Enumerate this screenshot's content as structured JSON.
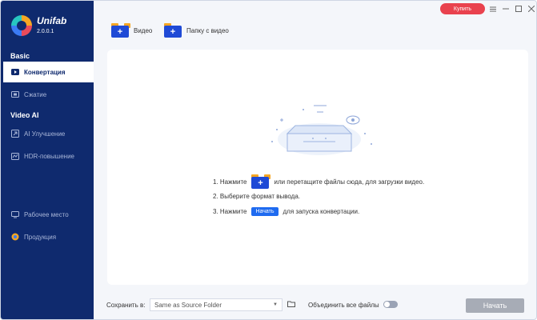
{
  "app": {
    "name": "Unifab",
    "version": "2.0.0.1"
  },
  "topbar": {
    "buy_label": "Купить",
    "add_video_label": "Видео",
    "add_folder_label": "Папку с видео"
  },
  "sidebar": {
    "section_basic": "Basic",
    "section_ai": "Video AI",
    "items": [
      {
        "label": "Конвертация",
        "icon": "play-icon"
      },
      {
        "label": "Сжатие",
        "icon": "compress-icon"
      },
      {
        "label": "AI Улучшение",
        "icon": "ai-upscale-icon"
      },
      {
        "label": "HDR-повышение",
        "icon": "hdr-icon"
      },
      {
        "label": "Рабочее место",
        "icon": "desktop-icon"
      },
      {
        "label": "Продукция",
        "icon": "product-icon"
      }
    ]
  },
  "instructions": {
    "step1_prefix": "1. Нажмите",
    "step1_suffix": "или перетащите файлы сюда, для загрузки видео.",
    "step2": "2. Выберите формат вывода.",
    "step3_prefix": "3. Нажмите",
    "step3_button": "Начать",
    "step3_suffix": "для запуска конвертации."
  },
  "bottombar": {
    "save_label": "Сохранить в:",
    "save_value": "Same as Source Folder",
    "merge_label": "Объединить все файлы",
    "merge_enabled": false,
    "start_label": "Начать"
  },
  "colors": {
    "sidebar_bg": "#0f2a6e",
    "accent": "#1f6bf0",
    "buy": "#e9424e"
  }
}
